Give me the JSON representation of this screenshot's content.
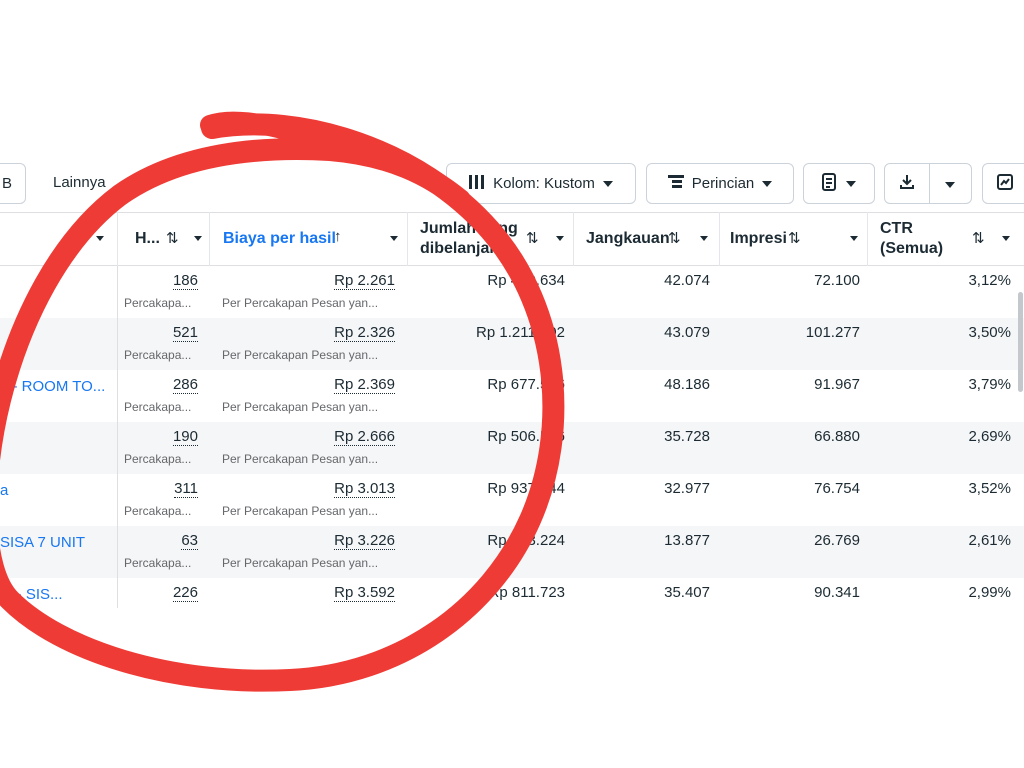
{
  "toolbar": {
    "left_partial": "B",
    "more_label": "Lainnya",
    "columns_label": "Kolom: Kustom",
    "breakdown_label": "Perincian",
    "icons": [
      "columns-icon",
      "breakdown-icon",
      "reports-icon",
      "download-icon",
      "chart-icon"
    ]
  },
  "table": {
    "headers": {
      "results": "H...",
      "cost_per_result": "Biaya per hasil",
      "amount_spent_line1": "Jumlah yang",
      "amount_spent_line2": "dibelanjakan",
      "reach": "Jangkauan",
      "impressions": "Impresi",
      "ctr_line1": "CTR",
      "ctr_line2": "(Semua)"
    },
    "rows": [
      {
        "name": "",
        "results": "186",
        "results_sub": "Percakapa...",
        "cost": "Rp 2.261",
        "cost_sub": "Per Percakapan Pesan yan...",
        "spent": "Rp 420.634",
        "reach": "42.074",
        "impressions": "72.100",
        "ctr": "3,12%"
      },
      {
        "name": "",
        "results": "521",
        "results_sub": "Percakapa...",
        "cost": "Rp 2.326",
        "cost_sub": "Per Percakapan Pesan yan...",
        "spent": "Rp 1.211.902",
        "reach": "43.079",
        "impressions": "101.277",
        "ctr": "3,50%"
      },
      {
        "name": "a - ROOM TO...",
        "results": "286",
        "results_sub": "Percakapa...",
        "cost": "Rp 2.369",
        "cost_sub": "Per Percakapan Pesan yan...",
        "spent": "Rp 677.516",
        "reach": "48.186",
        "impressions": "91.967",
        "ctr": "3,79%"
      },
      {
        "name": "",
        "results": "190",
        "results_sub": "Percakapa...",
        "cost": "Rp 2.666",
        "cost_sub": "Per Percakapan Pesan yan...",
        "spent": "Rp 506.526",
        "reach": "35.728",
        "impressions": "66.880",
        "ctr": "2,69%"
      },
      {
        "name": "a",
        "results": "311",
        "results_sub": "Percakapa...",
        "cost": "Rp 3.013",
        "cost_sub": "Per Percakapan Pesan yan...",
        "spent": "Rp 937.044",
        "reach": "32.977",
        "impressions": "76.754",
        "ctr": "3,52%"
      },
      {
        "name": "SISA 7 UNIT",
        "results": "63",
        "results_sub": "Percakapa...",
        "cost": "Rp 3.226",
        "cost_sub": "Per Percakapan Pesan yan...",
        "spent": "Rp 203.224",
        "reach": "13.877",
        "impressions": "26.769",
        "ctr": "2,61%"
      },
      {
        "name": "ta - SIS...",
        "results": "226",
        "results_sub": "",
        "cost": "Rp 3.592",
        "cost_sub": "",
        "spent": "Rp 811.723",
        "reach": "35.407",
        "impressions": "90.341",
        "ctr": "2,99%"
      }
    ]
  },
  "colors": {
    "link": "#1877f2",
    "annotation_ring": "#ef3b35",
    "text": "#1c2b33"
  }
}
